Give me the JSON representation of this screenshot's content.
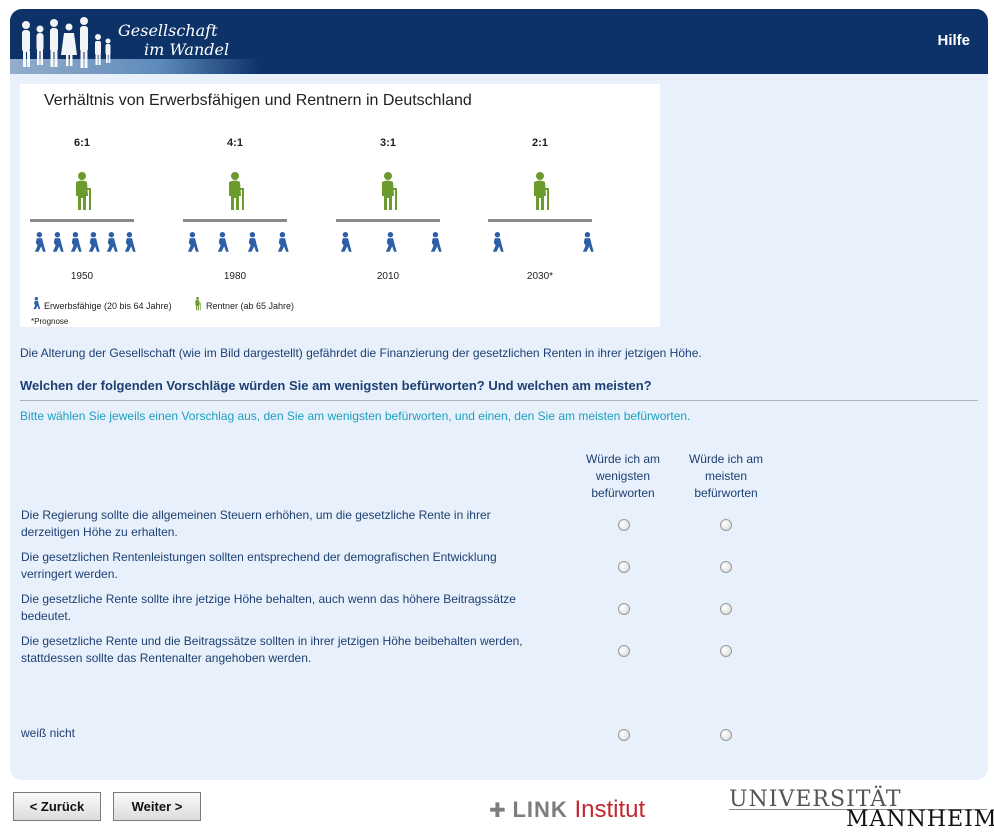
{
  "header": {
    "logo_line1": "Gesellschaft",
    "logo_line2": "im Wandel",
    "help_label": "Hilfe"
  },
  "chart": {
    "title": "Verhältnis von Erwerbsfähigen und Rentnern in Deutschland",
    "groups": [
      {
        "ratio": "6:1",
        "year": "1950",
        "workers": 6
      },
      {
        "ratio": "4:1",
        "year": "1980",
        "workers": 4
      },
      {
        "ratio": "3:1",
        "year": "2010",
        "workers": 3
      },
      {
        "ratio": "2:1",
        "year": "2030*",
        "workers": 2
      }
    ],
    "legend_workers": "Erwerbsfähige (20 bis 64 Jahre)",
    "legend_retirees": "Rentner (ab 65 Jahre)",
    "footnote": "*Prognose",
    "colors": {
      "worker": "#2c5fa6",
      "retiree": "#6b9a2e",
      "baseline": "#8a8a8a"
    }
  },
  "intro_text": "Die Alterung der Gesellschaft (wie im Bild dargestellt) gefährdet die Finanzierung der gesetzlichen Renten in ihrer jetzigen Höhe.",
  "question": "Welchen der folgenden Vorschläge würden Sie am wenigsten befürworten? Und welchen am meisten?",
  "instruction": "Bitte wählen Sie jeweils einen Vorschlag aus, den Sie am wenigsten befürworten, und einen, den Sie am meisten befürworten.",
  "columns": {
    "least": [
      "Würde ich am",
      "wenigsten",
      "befürworten"
    ],
    "most": [
      "Würde ich am",
      "meisten",
      "befürworten"
    ]
  },
  "options": [
    {
      "line1": "Die Regierung sollte die allgemeinen Steuern erhöhen, um die gesetzliche Rente in ihrer",
      "line2": "derzeitigen Höhe zu erhalten."
    },
    {
      "line1": "Die gesetzlichen Rentenleistungen sollten entsprechend der demografischen Entwicklung",
      "line2": "verringert werden."
    },
    {
      "line1": "Die gesetzliche Rente sollte ihre jetzige Höhe behalten, auch wenn das höhere Beitragssätze",
      "line2": "bedeutet."
    },
    {
      "line1": "Die gesetzliche Rente und die Beitragssätze sollten in ihrer jetzigen Höhe beibehalten werden,",
      "line2": "stattdessen sollte das Rentenalter angehoben werden."
    }
  ],
  "dont_know": "weiß nicht",
  "buttons": {
    "back": "< Zurück",
    "next": "Weiter >"
  },
  "footer": {
    "link_word": "LINK",
    "link_institut": "Institut",
    "uni_line1": "UNIVERSITÄT",
    "uni_line2": "MANNHEIM"
  }
}
